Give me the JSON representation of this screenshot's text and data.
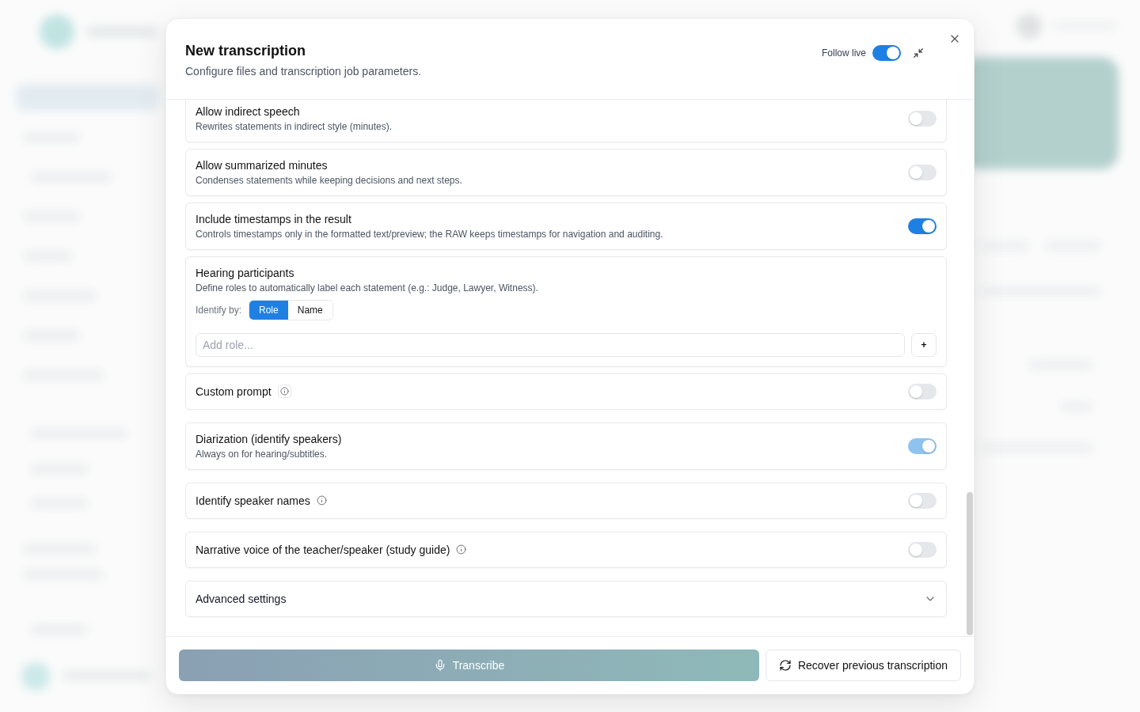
{
  "dialog": {
    "title": "New transcription",
    "subtitle": "Configure files and transcription job parameters.",
    "follow_live": {
      "label": "Follow live",
      "on": true
    }
  },
  "options": [
    {
      "kind": "toggle",
      "title": "Allow indirect speech",
      "description": "Rewrites statements in indirect style (minutes).",
      "info": false,
      "on": false,
      "disabled": false
    },
    {
      "kind": "toggle",
      "title": "Allow summarized minutes",
      "description": "Condenses statements while keeping decisions and next steps.",
      "info": false,
      "on": false,
      "disabled": false
    },
    {
      "kind": "toggle",
      "title": "Include timestamps in the result",
      "description": "Controls timestamps only in the formatted text/preview; the RAW keeps timestamps for navigation and auditing.",
      "info": false,
      "on": true,
      "disabled": false
    },
    {
      "kind": "participants",
      "title": "Hearing participants",
      "description": "Define roles to automatically label each statement (e.g.: Judge, Lawyer, Witness).",
      "identify_label": "Identify by:",
      "identify_by": [
        {
          "label": "Role",
          "selected": true
        },
        {
          "label": "Name",
          "selected": false
        }
      ],
      "input": {
        "placeholder": "Add role..."
      },
      "add_button": "+"
    },
    {
      "kind": "toggle",
      "title": "Custom prompt",
      "info": true,
      "info_framed": true,
      "on": false,
      "disabled": false
    },
    {
      "kind": "toggle",
      "title": "Diarization (identify speakers)",
      "description": "Always on for hearing/subtitles.",
      "info": false,
      "on": true,
      "disabled": true
    },
    {
      "kind": "toggle",
      "title": "Identify speaker names",
      "info": true,
      "info_framed": false,
      "on": false,
      "disabled": false
    },
    {
      "kind": "toggle",
      "title": "Narrative voice of the teacher/speaker (study guide)",
      "info": true,
      "info_framed": false,
      "on": false,
      "disabled": false
    },
    {
      "kind": "collapsible",
      "title": "Advanced settings",
      "expanded": false
    }
  ],
  "footer": {
    "buttons": [
      {
        "kind": "primary",
        "label": "Transcribe",
        "disabled": true
      },
      {
        "kind": "secondary",
        "label": "Recover previous transcription",
        "disabled": false
      }
    ]
  }
}
